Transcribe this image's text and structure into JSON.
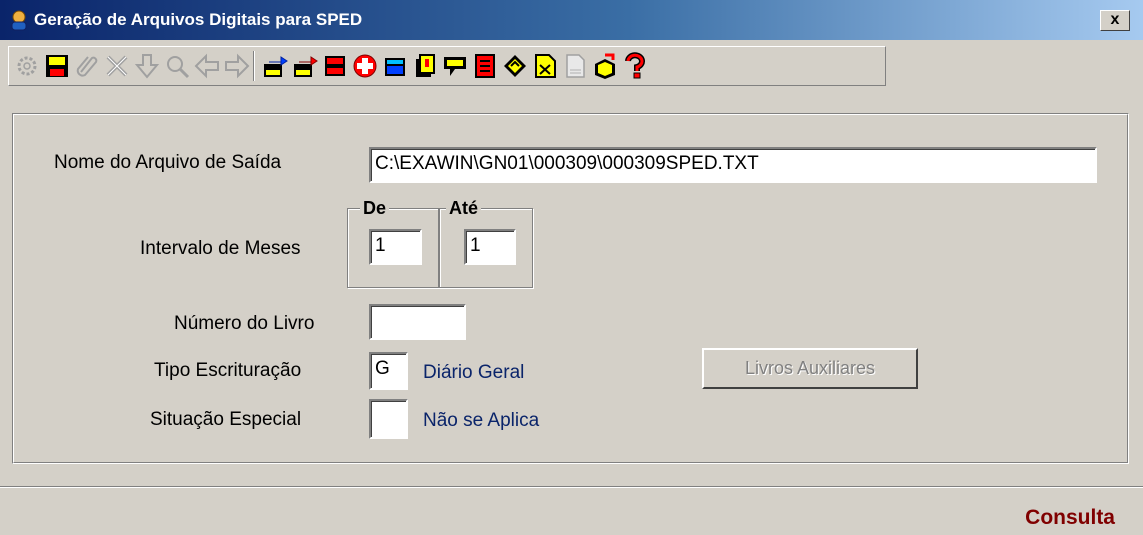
{
  "window": {
    "title": "Geração de Arquivos Digitais para SPED",
    "close_label": "x"
  },
  "toolbar": {
    "buttons": [
      {
        "icon": "gear-icon",
        "enabled": false
      },
      {
        "icon": "floppy-save-icon",
        "enabled": true,
        "color": "#ffff00"
      },
      {
        "icon": "paperclip-icon",
        "enabled": false
      },
      {
        "icon": "tools-icon",
        "enabled": false
      },
      {
        "icon": "down-arrow-icon",
        "enabled": false
      },
      {
        "icon": "magnifier-icon",
        "enabled": false
      },
      {
        "icon": "left-arrow-icon",
        "enabled": false
      },
      {
        "icon": "right-arrow-icon",
        "enabled": false
      },
      {
        "icon": "export-txt-icon",
        "enabled": true
      },
      {
        "icon": "export-txt-red-icon",
        "enabled": true
      },
      {
        "icon": "list-red-icon",
        "enabled": true
      },
      {
        "icon": "plus-red-icon",
        "enabled": true
      },
      {
        "icon": "calculator-icon",
        "enabled": true
      },
      {
        "icon": "notes-icon",
        "enabled": true
      },
      {
        "icon": "speech-bubble-icon",
        "enabled": true
      },
      {
        "icon": "document-red-icon",
        "enabled": true
      },
      {
        "icon": "diamond-arrows-icon",
        "enabled": true
      },
      {
        "icon": "document-scissors-icon",
        "enabled": true
      },
      {
        "icon": "blank-document-icon",
        "enabled": false
      },
      {
        "icon": "box-arrow-icon",
        "enabled": true
      },
      {
        "icon": "question-red-icon",
        "enabled": true
      }
    ]
  },
  "form": {
    "output_file_label": "Nome do Arquivo de Saída",
    "output_file_value": "C:\\EXAWIN\\GN01\\000309\\000309SPED.TXT",
    "months_label": "Intervalo de Meses",
    "from_title": "De",
    "from_value": "1",
    "to_title": "Até",
    "to_value": "1",
    "book_number_label": "Número do Livro",
    "book_number_value": "",
    "bookkeeping_type_label": "Tipo Escrituração",
    "bookkeeping_type_value": "G",
    "bookkeeping_type_desc": "Diário Geral",
    "special_situation_label": "Situação Especial",
    "special_situation_value": "",
    "special_situation_desc": "Não se Aplica",
    "aux_books_button": "Livros Auxiliares"
  },
  "status": {
    "mode": "Consulta"
  }
}
